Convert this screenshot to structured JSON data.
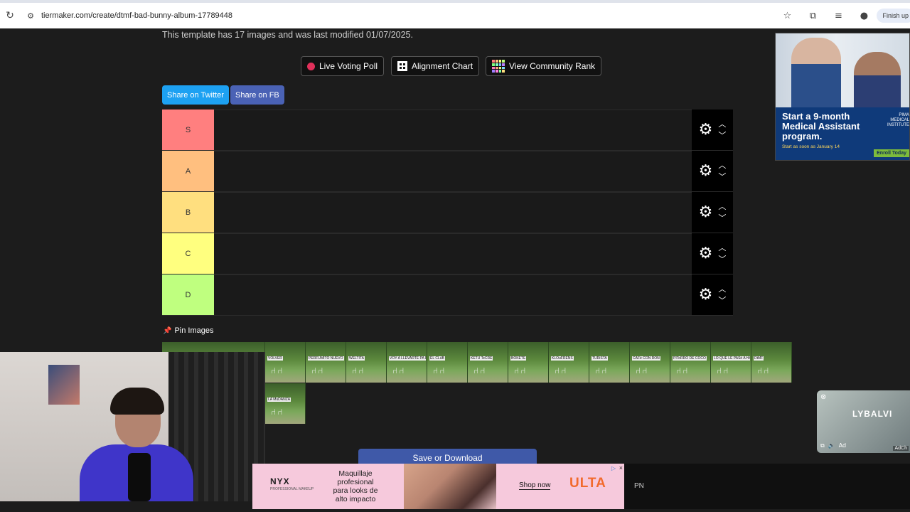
{
  "browser": {
    "url": "tiermaker.com/create/dtmf-bad-bunny-album-17789448",
    "finish_label": "Finish up"
  },
  "template_info": "This template has 17 images and was last modified 01/07/2025.",
  "buttons": {
    "live_poll": "Live Voting Poll",
    "alignment": "Alignment Chart",
    "community": "View Community Rank",
    "share_twitter": "Share on Twitter",
    "share_fb": "Share on FB",
    "save": "Save or Download"
  },
  "colors": {
    "twitter": "#1da1f2",
    "fb": "#4267b2",
    "tier_s": "#ff7f7f",
    "tier_a": "#ffbf7f",
    "tier_b": "#ffdf7f",
    "tier_c": "#ffff7f",
    "tier_d": "#bfff7f"
  },
  "tiers": [
    {
      "label": "S",
      "color": "#ff7f7f"
    },
    {
      "label": "A",
      "color": "#ffbf7f"
    },
    {
      "label": "B",
      "color": "#ffdf7f"
    },
    {
      "label": "C",
      "color": "#ffff7f"
    },
    {
      "label": "D",
      "color": "#bfff7f"
    }
  ],
  "pin_label": "Pin Images",
  "pool_images": [
    "",
    "VOLVER",
    "PERFUMITO NUEVO",
    "WELTITA",
    "VOY A LLEVARTE PA PR",
    "EL CLúB",
    "KETU TeCRE",
    "BOKETE",
    "KLOuFRENS",
    "TURiSTA",
    "CAFé CON RON",
    "PIToRRO DE COCO",
    "LO QUE LE PASó A HAWAii",
    "DtMF",
    "LA MuDANZA"
  ],
  "ads": {
    "right": {
      "headline": "Start a 9-month Medical Assistant program.",
      "sub": "Start as soon as January 14",
      "brand": "PIMA MEDICAL INSTITUTE",
      "cta": "Enroll Today"
    },
    "video": {
      "logo": "LYBALVI",
      "ad_tag": "Ad",
      "adchoices": "AdCh"
    },
    "bottom": {
      "brand": "NYX",
      "brand_sub": "PROFESSIONAL MAKEUP",
      "copy": "Maquillaje profesional para looks de alto impacto",
      "cta": "Shop now",
      "retailer": "ULTA"
    },
    "strip_text": "PN"
  }
}
